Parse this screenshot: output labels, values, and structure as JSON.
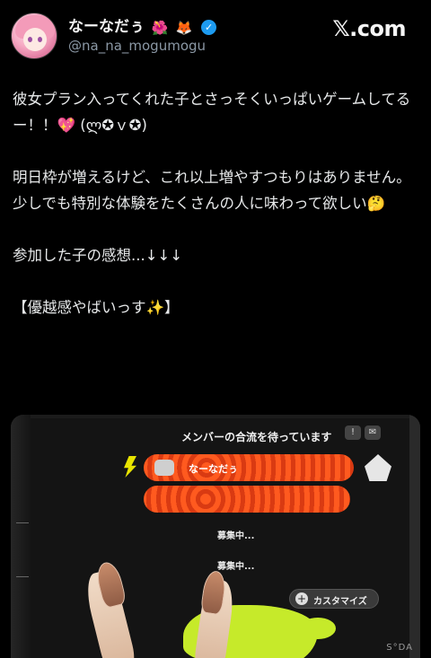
{
  "header": {
    "display_name": "なーなだぅ",
    "name_emojis": [
      "🌺",
      "🦊"
    ],
    "verified_icon": "✓",
    "handle": "@na_na_mogumogu",
    "brand": "𝕏.com"
  },
  "tweet": {
    "text": "彼女プラン入ってくれた子とさっそくいっぱいゲームしてるー！！💖 (ლ✪ｖ✪)\n\n明日枠が増えるけど、これ以上増やすつもりはありません。\n少しでも特別な体験をたくさんの人に味わって欲しい🤔\n\n参加した子の感想...↓↓↓\n\n【優越感やばいっす✨】"
  },
  "media": {
    "game_title": "メンバーの合流を待っています",
    "player_name": "なーなだぅ",
    "slot_label_1": "募集中...",
    "slot_label_2": "募集中...",
    "customize_label": "カスタマイズ",
    "watermark": "S°DA",
    "colors": {
      "bar": "#ff5a1f",
      "splat": "#c6ea2a",
      "bolt": "#e8e400"
    }
  }
}
